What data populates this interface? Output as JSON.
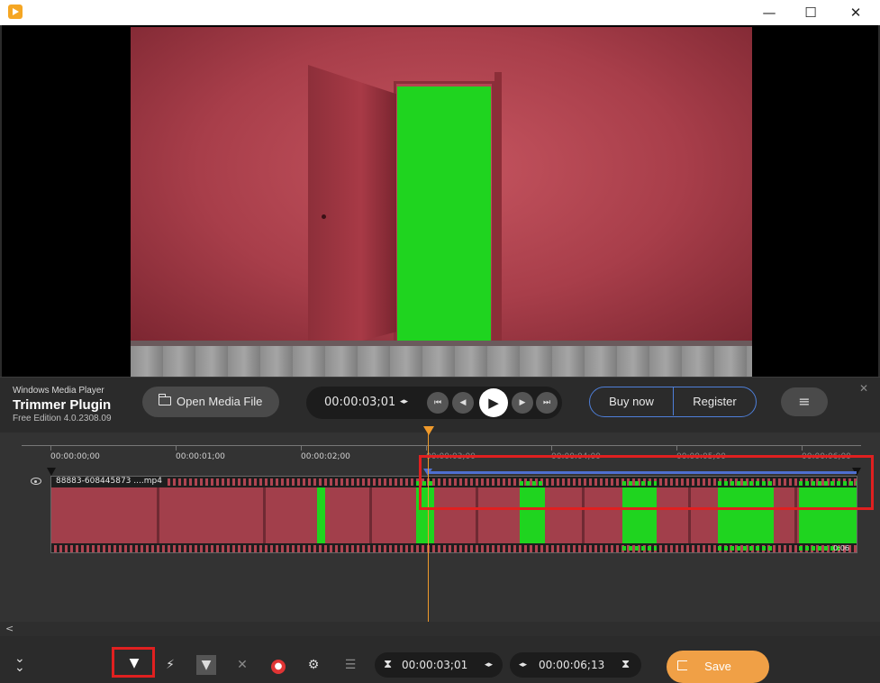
{
  "titlebar": {
    "minimize": "—",
    "maximize": "☐",
    "close": "✕"
  },
  "brand": {
    "small": "Windows Media Player",
    "name": "Trimmer Plugin",
    "version": "Free Edition 4.0.2308.09"
  },
  "controls": {
    "open_label": "Open Media File",
    "current_time": "00:00:03;01",
    "buy_label": "Buy now",
    "register_label": "Register",
    "menu_glyph": "≡"
  },
  "timeline": {
    "ruler_labels": [
      "00:00:00;00",
      "00:00:01;00",
      "00:00:02;00",
      "00:00:03;00",
      "00:00:04;00",
      "00:00:05;00",
      "00:00:06;00"
    ],
    "file_label": "88883-608445873  ....mp4",
    "duration_label": "0:06",
    "playhead_time": "00:00:03;01"
  },
  "bottom": {
    "start_time": "00:00:03;01",
    "end_time": "00:00:06;13",
    "save_label": "Save"
  },
  "colors": {
    "accent_orange": "#f0a046",
    "playhead": "#f09a2b",
    "selection_blue": "#4e6fd0",
    "highlight_red": "#e02020",
    "green_screen": "#1fd41f"
  },
  "icons": [
    "app-icon",
    "folder-icon",
    "eye-icon",
    "filter-icon",
    "split-icon",
    "trim-filter-icon",
    "mute-icon",
    "snapshot-icon",
    "settings-icon",
    "equalizer-icon",
    "flag-icon",
    "collapse-icon"
  ]
}
